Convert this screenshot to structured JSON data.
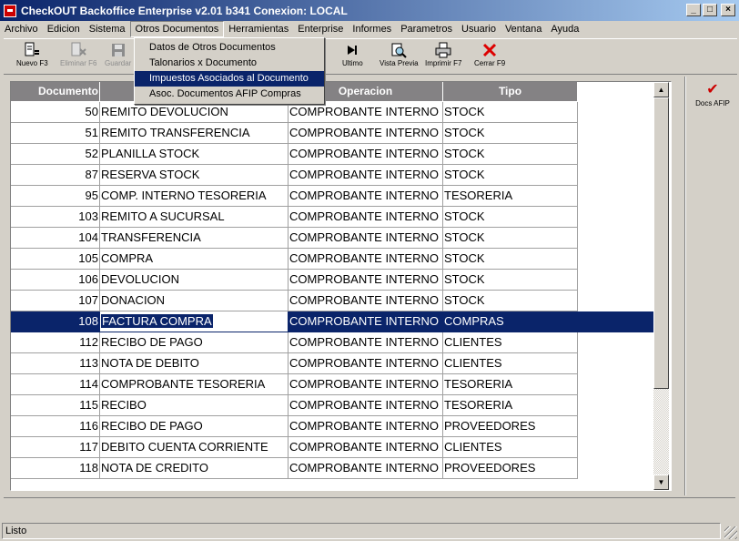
{
  "window": {
    "title": "CheckOUT Backoffice Enterprise v2.01 b341 Conexion: LOCAL"
  },
  "menubar": [
    "Archivo",
    "Edicion",
    "Sistema",
    "Otros Documentos",
    "Herramientas",
    "Enterprise",
    "Informes",
    "Parametros",
    "Usuario",
    "Ventana",
    "Ayuda"
  ],
  "menubar_active": "Otros Documentos",
  "dropdown": {
    "items": [
      "Datos de Otros Documentos",
      "Talonarios x Documento",
      "Impuestos Asociados al Documento",
      "Asoc. Documentos AFIP Compras"
    ],
    "selected": "Impuestos Asociados al Documento"
  },
  "toolbar": {
    "nuevo": "Nuevo F3",
    "eliminar": "Eliminar F6",
    "guardar": "Guardar",
    "ultimo": "Ultimo",
    "vista_previa": "Vista Previa",
    "imprimir": "Imprimir F7",
    "cerrar": "Cerrar F9"
  },
  "right_panel": {
    "docs_afip": "Docs AFIP"
  },
  "grid": {
    "columns": [
      "Documento",
      "",
      "Operacion",
      "Tipo"
    ],
    "rows": [
      [
        "50",
        "REMITO DEVOLUCION",
        "COMPROBANTE INTERNO",
        "STOCK"
      ],
      [
        "51",
        "REMITO TRANSFERENCIA",
        "COMPROBANTE INTERNO",
        "STOCK"
      ],
      [
        "52",
        "PLANILLA STOCK",
        "COMPROBANTE INTERNO",
        "STOCK"
      ],
      [
        "87",
        "RESERVA STOCK",
        "COMPROBANTE INTERNO",
        "STOCK"
      ],
      [
        "95",
        "COMP. INTERNO TESORERIA",
        "COMPROBANTE INTERNO",
        "TESORERIA"
      ],
      [
        "103",
        "REMITO A SUCURSAL",
        "COMPROBANTE INTERNO",
        "STOCK"
      ],
      [
        "104",
        "TRANSFERENCIA",
        "COMPROBANTE INTERNO",
        "STOCK"
      ],
      [
        "105",
        "COMPRA",
        "COMPROBANTE INTERNO",
        "STOCK"
      ],
      [
        "106",
        "DEVOLUCION",
        "COMPROBANTE INTERNO",
        "STOCK"
      ],
      [
        "107",
        "DONACION",
        "COMPROBANTE INTERNO",
        "STOCK"
      ],
      [
        "108",
        "FACTURA COMPRA",
        "COMPROBANTE INTERNO",
        "COMPRAS"
      ],
      [
        "112",
        "RECIBO DE PAGO",
        "COMPROBANTE INTERNO",
        "CLIENTES"
      ],
      [
        "113",
        "NOTA DE DEBITO",
        "COMPROBANTE INTERNO",
        "CLIENTES"
      ],
      [
        "114",
        "COMPROBANTE TESORERIA",
        "COMPROBANTE INTERNO",
        "TESORERIA"
      ],
      [
        "115",
        "RECIBO",
        "COMPROBANTE INTERNO",
        "TESORERIA"
      ],
      [
        "116",
        "RECIBO DE PAGO",
        "COMPROBANTE INTERNO",
        "PROVEEDORES"
      ],
      [
        "117",
        "DEBITO CUENTA CORRIENTE",
        "COMPROBANTE INTERNO",
        "CLIENTES"
      ],
      [
        "118",
        "NOTA DE CREDITO",
        "COMPROBANTE INTERNO",
        "PROVEEDORES"
      ]
    ],
    "selected_row": 10
  },
  "status": {
    "text": "Listo"
  },
  "colors": {
    "title_start": "#0a246a",
    "selection": "#0a246a",
    "header": "#848284",
    "face": "#d4d0c8"
  }
}
